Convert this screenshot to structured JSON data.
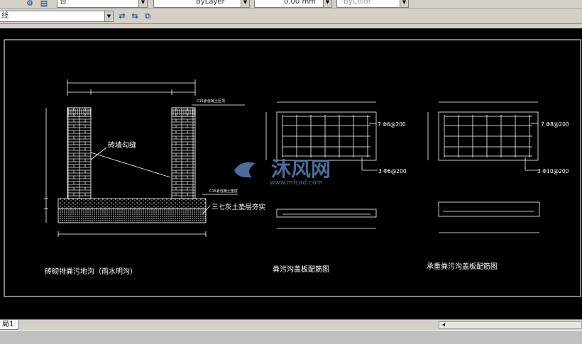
{
  "toolbar": {
    "layer_combo": "台",
    "color_combo": "ByLayer",
    "lineweight_combo": "0.00 mm",
    "plotstyle_combo": "ByColor",
    "linetype_combo": "线"
  },
  "drawing": {
    "left_callout_top": "C15素混凝土压顶",
    "left_callout_joint": "砖墙勾缝",
    "left_callout_bottom": "C15素混凝土垫层",
    "left_callout_base": "三七灰土垫层夯实",
    "left_title": "砖砌排粪污地沟（雨水明沟）",
    "mid_label_top": "7 Φ6@200",
    "mid_label_bottom": "3 Φ6@200",
    "mid_title": "粪污沟盖板配筋图",
    "right_label_top": "7 Φ8@200",
    "right_label_bottom": "3 Φ10@200",
    "right_title": "承重粪污沟盖板配筋图",
    "watermark_text": "沐风网",
    "watermark_url": "www.mfcad.com"
  },
  "tabs": {
    "layout1": "局1"
  },
  "colors": {
    "canvas_bg": "#000000",
    "line": "#ffffff",
    "watermark": "#5a7fb5"
  }
}
